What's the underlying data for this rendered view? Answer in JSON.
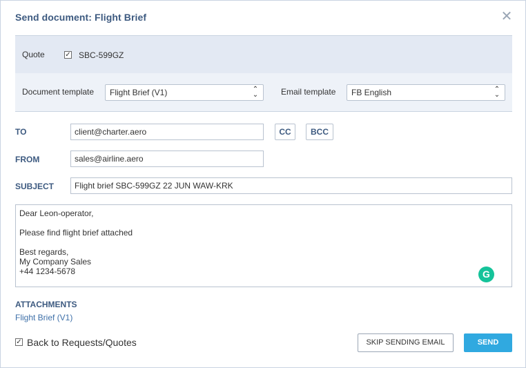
{
  "dialog": {
    "title": "Send document: Flight Brief",
    "close_icon": "close-icon"
  },
  "quote": {
    "label": "Quote",
    "checked": true,
    "value": "SBC-599GZ"
  },
  "templates": {
    "document_label": "Document template",
    "document_value": "Flight Brief (V1)",
    "email_label": "Email template",
    "email_value": "FB English"
  },
  "to": {
    "label": "TO",
    "value": "client@charter.aero",
    "cc_label": "CC",
    "bcc_label": "BCC"
  },
  "from": {
    "label": "FROM",
    "value": "sales@airline.aero"
  },
  "subject": {
    "label": "SUBJECT",
    "value": "Flight brief SBC-599GZ 22 JUN WAW-KRK"
  },
  "message": {
    "line1": "Dear Leon-operator,",
    "line2": "Please find flight brief attached",
    "line3": "Best regards,",
    "line4": "My Company Sales",
    "line5": "+44 1234-5678",
    "grammarly_icon": "G"
  },
  "attachments": {
    "heading": "ATTACHMENTS",
    "items": [
      "Flight Brief (V1)"
    ]
  },
  "footer": {
    "back_label": "Back to Requests/Quotes",
    "back_checked": true,
    "skip_label": "SKIP SENDING EMAIL",
    "send_label": "SEND"
  },
  "colors": {
    "accent": "#3d5a80",
    "send_button": "#30a9e0",
    "band": "#e3e9f3",
    "grammarly": "#15c39a"
  }
}
